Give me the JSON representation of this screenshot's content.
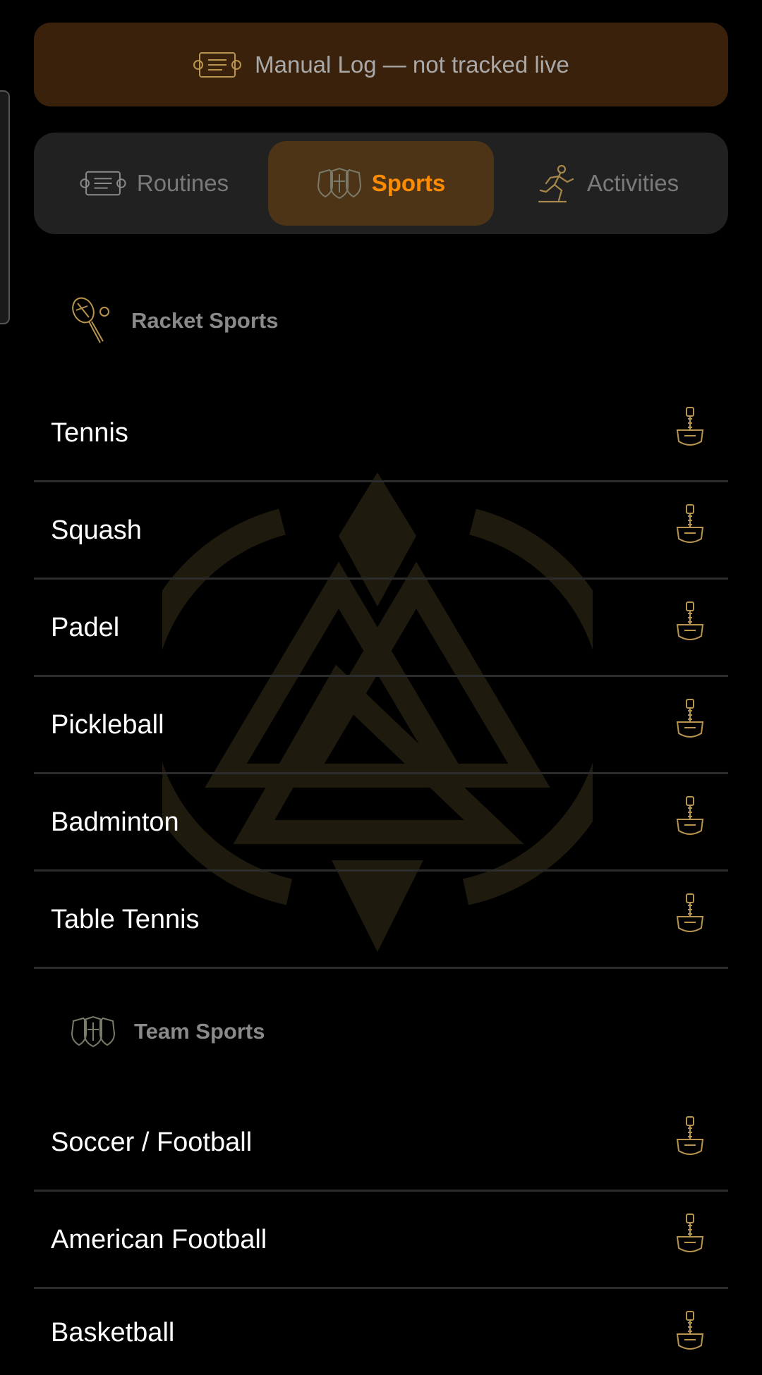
{
  "banner": {
    "icon": "scroll-icon",
    "text": "Manual Log — not tracked live"
  },
  "tabs": [
    {
      "label": "Routines",
      "icon": "scroll-icon",
      "active": false
    },
    {
      "label": "Sports",
      "icon": "shields-icon",
      "active": true
    },
    {
      "label": "Activities",
      "icon": "runner-icon",
      "active": false
    }
  ],
  "sections": [
    {
      "title": "Racket Sports",
      "icon": "racket-icon",
      "items": [
        "Tennis",
        "Squash",
        "Padel",
        "Pickleball",
        "Badminton",
        "Table Tennis"
      ]
    },
    {
      "title": "Team Sports",
      "icon": "shields-icon",
      "items": [
        "Soccer / Football",
        "American Football",
        "Basketball"
      ]
    }
  ],
  "colors": {
    "accent": "#ff8c00",
    "banner_bg": "#3a210b",
    "active_tab_bg": "#4d3417",
    "icon_gold": "#b8944e"
  },
  "row_action_icon": "hammer-icon"
}
